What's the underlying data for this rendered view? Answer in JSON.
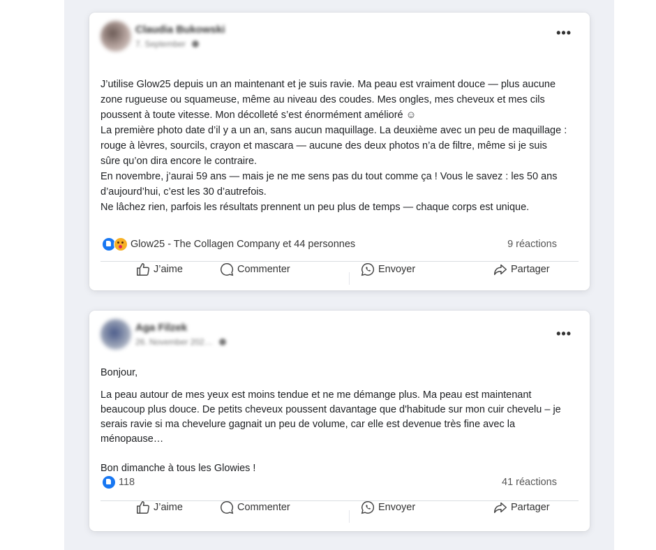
{
  "posts": [
    {
      "author": "Claudia Bukowski",
      "date": "7. September",
      "paragraphs": [
        "J’utilise Glow25 depuis un an maintenant et je suis ravie. Ma peau est vraiment douce — plus aucune zone rugueuse ou squameuse, même au niveau des coudes. Mes ongles, mes cheveux et mes cils poussent à toute vitesse. Mon décolleté s’est énormément amélioré ☺",
        "La première photo date d’il y a un an, sans aucun maquillage. La deuxième avec un peu de maquillage : rouge à lèvres, sourcils, crayon et mascara — aucune des deux photos n’a de filtre, même si je suis sûre qu’on dira encore le contraire.",
        "En novembre, j’aurai 59 ans — mais je ne me sens pas du tout comme ça ! Vous le savez : les 50 ans d’aujourd’hui, c’est les 30 d’autrefois.",
        "Ne lâchez rien, parfois les résultats prennent un peu plus de temps — chaque corps est unique."
      ],
      "reactions_text": "Glow25 - The Collagen Company et 44 personnes",
      "reactions_count": "9 réactions"
    },
    {
      "author": "Aga Filzek",
      "date": "26. November 202…",
      "greeting": "Bonjour,",
      "paragraph": "La peau autour de mes yeux est moins tendue et ne me démange plus. Ma peau est maintenant beaucoup plus douce. De petits cheveux poussent davantage que d'habitude sur mon cuir chevelu – je serais ravie si ma chevelure gagnait un peu de volume, car elle est devenue très fine avec la ménopause…",
      "closing": "Bon dimanche à tous les Glowies !",
      "reactions_text": "118",
      "reactions_count": "41 réactions"
    }
  ],
  "actions": {
    "like": "J’aime",
    "comment": "Commenter",
    "send": "Envoyer",
    "share": "Partager"
  },
  "more_label": "•••",
  "colors": {
    "like_blue": "#1877f2",
    "wow_yellow": "#f7b125",
    "feed_bg": "#eef0f5"
  }
}
